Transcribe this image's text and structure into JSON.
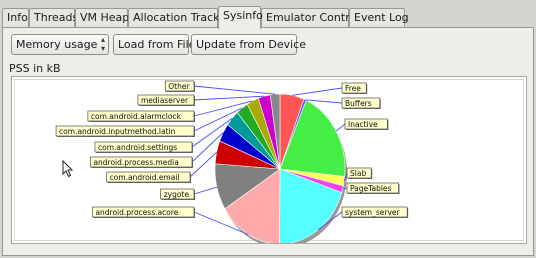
{
  "tabs": [
    {
      "label": "Info",
      "active": false
    },
    {
      "label": "Threads",
      "active": false
    },
    {
      "label": "VM Heap",
      "active": false
    },
    {
      "label": "Allocation Tracker",
      "active": false
    },
    {
      "label": "Sysinfo",
      "active": true
    },
    {
      "label": "Emulator Control",
      "active": false
    },
    {
      "label": "Event Log",
      "active": false
    }
  ],
  "toolbar": {
    "combo_value": "Memory usage",
    "load_button": "Load from File",
    "update_button": "Update from Device"
  },
  "chart_subtitle": "PSS in kB",
  "chart_data": {
    "type": "pie",
    "title": "",
    "slices": [
      {
        "label": "Free",
        "value": 6,
        "color": "#ff5555"
      },
      {
        "label": "Buffers",
        "value": 0.6,
        "color": "#5555ff"
      },
      {
        "label": "Inactive",
        "value": 20,
        "color": "#44ee44"
      },
      {
        "label": "Slab",
        "value": 2,
        "color": "#ffff55"
      },
      {
        "label": "PageTables",
        "value": 1.5,
        "color": "#ee44ee"
      },
      {
        "label": "system_server",
        "value": 20,
        "color": "#55ffff"
      },
      {
        "label": "android.process.acore",
        "value": 16,
        "color": "#ffaaaa"
      },
      {
        "label": "zygote",
        "value": 10,
        "color": "#808080"
      },
      {
        "label": "com.android.email",
        "value": 5,
        "color": "#cc0000"
      },
      {
        "label": "android.process.media",
        "value": 4,
        "color": "#0000cc"
      },
      {
        "label": "com.android.settings",
        "value": 3.5,
        "color": "#009a9a"
      },
      {
        "label": "com.android.inputmethod.latin",
        "value": 3,
        "color": "#22aa22"
      },
      {
        "label": "com.android.alarmclock",
        "value": 3,
        "color": "#aaaa00"
      },
      {
        "label": "mediaserver",
        "value": 3,
        "color": "#cc00cc"
      },
      {
        "label": "Other",
        "value": 2.4,
        "color": "#888888"
      }
    ]
  }
}
